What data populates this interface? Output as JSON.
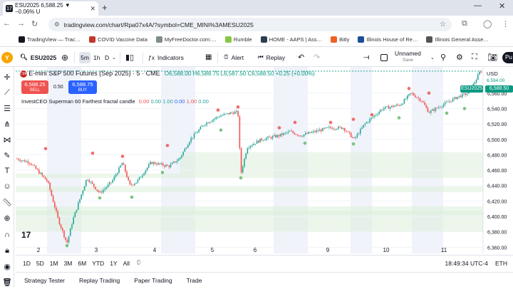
{
  "browser": {
    "tab_title": "ESU2025 6,588.25 ▼ −0.06% U",
    "favicon_text": "17",
    "new_tab": "+",
    "url": "tradingview.com/chart/Rpa07x4A/?symbol=CME_MINI%3AMESU2025",
    "bookmarks": [
      {
        "label": "TradingView — Trac…",
        "color": "#131722"
      },
      {
        "label": "COVID Vaccine Data",
        "color": "#c0392b"
      },
      {
        "label": "MyFreeDoctor.com:…",
        "color": "#7f8c8d"
      },
      {
        "label": "Rumble",
        "color": "#85c742"
      },
      {
        "label": "HOME - AAPS | Ass…",
        "color": "#2c3e50"
      },
      {
        "label": "Bitly",
        "color": "#ee6123"
      },
      {
        "label": "Illinois House of Re…",
        "color": "#1f4e99"
      },
      {
        "label": "Illinois General Asse…",
        "color": "#555555"
      }
    ]
  },
  "toolbar": {
    "avatar": "Y",
    "symbol": "ESU2025",
    "intervals": [
      "5m",
      "1h",
      "D"
    ],
    "indicators": "Indicators",
    "alert": "Alert",
    "replay": "Replay",
    "layout_name": "Unnamed",
    "layout_save": "Save",
    "publish": "Pu"
  },
  "chart": {
    "title": "E-mini S&P 500 Futures (Sep 2025) · 5 · CME",
    "ohlc": {
      "o": "O6,588.00",
      "h": "H6,588.75",
      "l": "L6,587.50",
      "c": "C6,588.50",
      "chg": "+0.25 (+0.00%)"
    },
    "sell_price": "6,588.25",
    "sell_label": "SELL",
    "spread": "0.50",
    "buy_price": "6,588.75",
    "buy_label": "BUY",
    "indicator_name": "InvestCEO Superman 60 Farthest fractal candle",
    "indicator_values": [
      "0.00",
      "0.00",
      "1.00",
      "0.00",
      "1.00",
      "0.00"
    ],
    "currency": "USD",
    "last_price": "6,588.50",
    "symbol_tag": "ESU2025",
    "partial_price": "6,594.00",
    "y_ticks": [
      "6,560.00",
      "6,540.00",
      "6,520.00",
      "6,500.00",
      "6,480.00",
      "6,460.00",
      "6,440.00",
      "6,420.00",
      "6,400.00",
      "6,380.00",
      "6,360.00"
    ],
    "x_ticks": [
      "2",
      "3",
      "4",
      "5",
      "6",
      "9",
      "10",
      "11"
    ],
    "watermark": "17"
  },
  "chart_data": {
    "type": "candlestick",
    "title": "E-mini S&P 500 Futures (Sep 2025) · 5 · CME",
    "x": [
      "2",
      "3",
      "4",
      "5",
      "6",
      "9",
      "10",
      "11"
    ],
    "y_close_approx": [
      6475,
      6380,
      6435,
      6475,
      6530,
      6470,
      6510,
      6505,
      6525,
      6545,
      6555,
      6588.5
    ],
    "ylim": [
      6352,
      6594
    ],
    "last": 6588.5
  },
  "range": {
    "buttons": [
      "1D",
      "5D",
      "1M",
      "3M",
      "6M",
      "YTD",
      "1Y",
      "All"
    ],
    "clock": "18:49:34 UTC-4",
    "session": "ETH"
  },
  "bottom_tabs": [
    "Strategy Tester",
    "Replay Trading",
    "Paper Trading",
    "Trade"
  ],
  "colors": {
    "up": "#26a69a",
    "down": "#ef5350",
    "accent": "#2962ff",
    "zone": "#dcefd8"
  }
}
